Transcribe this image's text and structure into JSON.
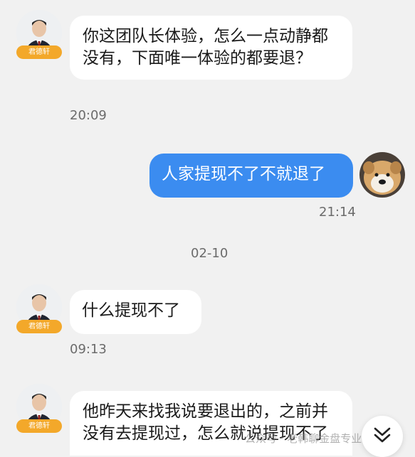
{
  "messages": [
    {
      "side": "left",
      "sender_badge": "君德轩",
      "text": "你这团队长体验，怎么一点动静都没有，下面唯一体验的都要退？",
      "time": "20:09"
    },
    {
      "side": "right",
      "text": "人家提现不了不就退了",
      "time": "21:14"
    },
    {
      "date_divider": "02-10"
    },
    {
      "side": "left",
      "sender_badge": "君德轩",
      "text": "什么提现不了",
      "time": "09:13"
    },
    {
      "side": "left",
      "sender_badge": "君德轩",
      "text": "他昨天来找我说要退出的，之前并没有去提现过，怎么就说提现不了"
    }
  ],
  "watermark": "公众号 · 老韩聊金盘专业分析",
  "colors": {
    "own_bubble": "#3b8cf0",
    "badge": "#f3a82a",
    "background": "#f1f1f1"
  },
  "icons": {
    "scroll_down": "chevron-double-down-icon"
  }
}
